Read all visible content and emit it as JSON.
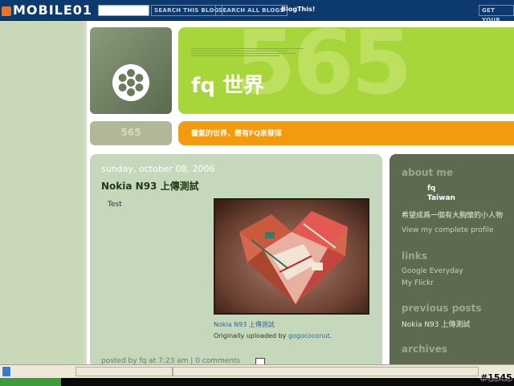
{
  "navbar": {
    "logo": "MOBILE01",
    "search_blog": "SEARCH THIS BLOG",
    "search_all": "SEARCH ALL BLOGS",
    "blog_this": "BlogThis!",
    "get_your": "GET YOUR"
  },
  "header": {
    "watermark": "565",
    "title": "fq 世界",
    "number": "565",
    "tagline": "靈氣的世界，盡有FQ來發揮"
  },
  "post": {
    "date": "sunday, october 08, 2006",
    "title": "Nokia N93 上傳測試",
    "body": "Test",
    "photo_caption": "Nokia N93 上傳測試",
    "uploaded_prefix": "Originally uploaded by ",
    "uploader": "gogococonut",
    "uploaded_suffix": ".",
    "footer": "posted by fq at 7:23 am  |  0 comments"
  },
  "sidebar": {
    "about_heading": "about me",
    "name": "fq",
    "location": "Taiwan",
    "bio": "希望成爲一個有大胸懷的小人物",
    "profile_link": "View my complete profile",
    "links_heading": "links",
    "links": [
      "Google Everyday",
      "My Flickr"
    ],
    "previous_heading": "previous posts",
    "previous_posts": [
      "Nokia N93 上傳測試"
    ],
    "archives_heading": "archives"
  },
  "overlay": {
    "image_id": "#1545"
  },
  "colors": {
    "navbar": "#0c3a6e",
    "header_green": "#a6d63a",
    "orange": "#f39a0f",
    "post_bg": "#c6d8bc",
    "sidebar_bg": "#5d6a50"
  }
}
